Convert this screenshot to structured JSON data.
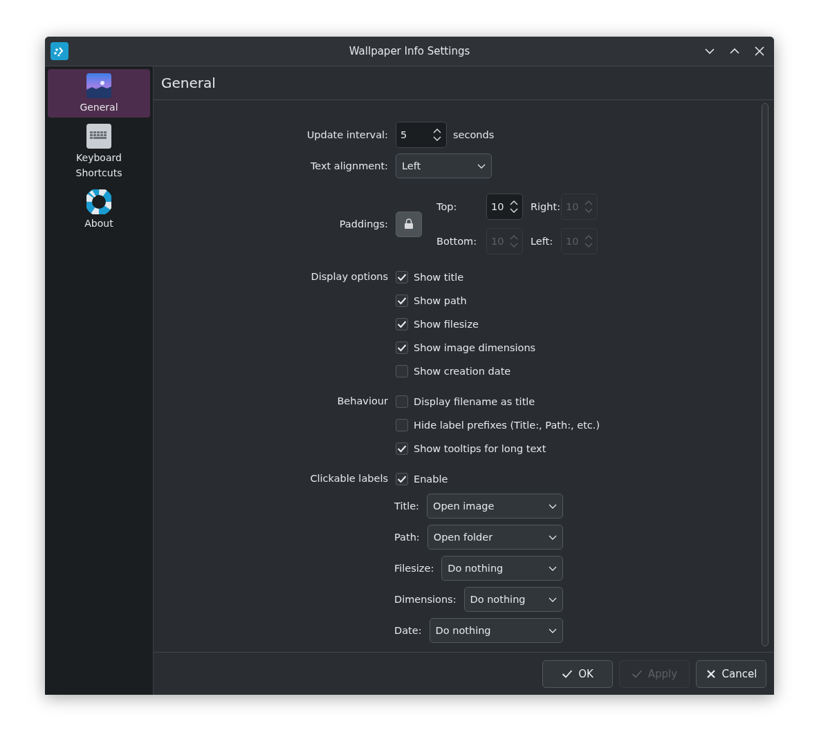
{
  "window": {
    "title": "Wallpaper Info Settings"
  },
  "sidebar": {
    "items": [
      {
        "label": "General",
        "kind": "picture",
        "selected": true
      },
      {
        "label": "Keyboard Shortcuts",
        "kind": "keyboard",
        "selected": false
      },
      {
        "label": "About",
        "kind": "help",
        "selected": false
      }
    ]
  },
  "page": {
    "title": "General"
  },
  "update_interval": {
    "label": "Update interval:",
    "value": "5",
    "unit": "seconds"
  },
  "text_alignment": {
    "label": "Text alignment:",
    "value": "Left"
  },
  "paddings": {
    "label": "Paddings:",
    "locked": true,
    "fields": [
      {
        "label": "Top:",
        "value": "10",
        "disabled": false
      },
      {
        "label": "Right:",
        "value": "10",
        "disabled": true
      },
      {
        "label": "Bottom:",
        "value": "10",
        "disabled": true
      },
      {
        "label": "Left:",
        "value": "10",
        "disabled": true
      }
    ]
  },
  "groups": [
    {
      "label": "Display options",
      "options": [
        {
          "label": "Show title",
          "checked": true
        },
        {
          "label": "Show path",
          "checked": true
        },
        {
          "label": "Show filesize",
          "checked": true
        },
        {
          "label": "Show image dimensions",
          "checked": true
        },
        {
          "label": "Show creation date",
          "checked": false
        }
      ]
    },
    {
      "label": "Behaviour",
      "options": [
        {
          "label": "Display filename as title",
          "checked": false
        },
        {
          "label": "Hide label prefixes (Title:, Path:, etc.)",
          "checked": false
        },
        {
          "label": "Show tooltips for long text",
          "checked": true
        }
      ]
    },
    {
      "label": "Clickable labels",
      "options": [
        {
          "label": "Enable",
          "checked": true
        }
      ]
    }
  ],
  "click_actions": [
    {
      "label": "Title:",
      "value": "Open image"
    },
    {
      "label": "Path:",
      "value": "Open folder"
    },
    {
      "label": "Filesize:",
      "value": "Do nothing"
    },
    {
      "label": "Dimensions:",
      "value": "Do nothing"
    },
    {
      "label": "Date:",
      "value": "Do nothing"
    }
  ],
  "buttons": [
    {
      "label": "OK",
      "kind": "confirm",
      "disabled": false
    },
    {
      "label": "Apply",
      "kind": "confirm",
      "disabled": true
    },
    {
      "label": "Cancel",
      "kind": "cancel",
      "disabled": false
    }
  ]
}
